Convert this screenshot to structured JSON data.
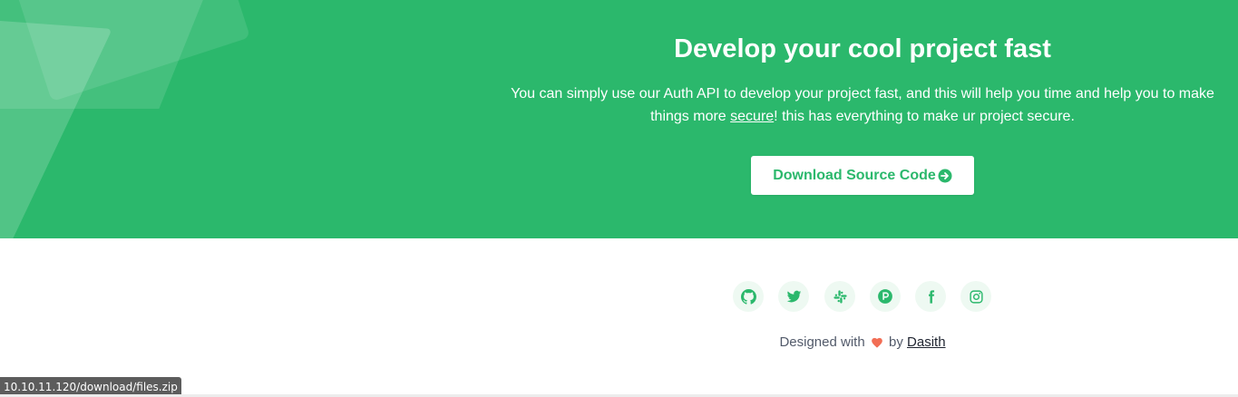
{
  "hero": {
    "title": "Develop your cool project fast",
    "text_before": "You can simply use our Auth API to develop your project fast, and this will help you time and help you to make things more ",
    "text_link": "secure",
    "text_after": "! this has everything to make ur project secure.",
    "button_label": "Download Source Code",
    "button_icon": "arrow-circle-right-icon",
    "background_color": "#2bb86c"
  },
  "footer": {
    "socials": [
      {
        "name": "github",
        "icon": "github-icon"
      },
      {
        "name": "twitter",
        "icon": "twitter-icon"
      },
      {
        "name": "slack",
        "icon": "slack-icon"
      },
      {
        "name": "product-hunt",
        "icon": "product-hunt-icon"
      },
      {
        "name": "facebook",
        "icon": "facebook-icon"
      },
      {
        "name": "instagram",
        "icon": "instagram-icon"
      }
    ],
    "designed_prefix": "Designed with",
    "designed_by": "by",
    "author": "Dasith",
    "heart_color": "#f26e55",
    "icon_color": "#2bb86c"
  },
  "status_bar": {
    "url": "10.10.11.120/download/files.zip"
  }
}
